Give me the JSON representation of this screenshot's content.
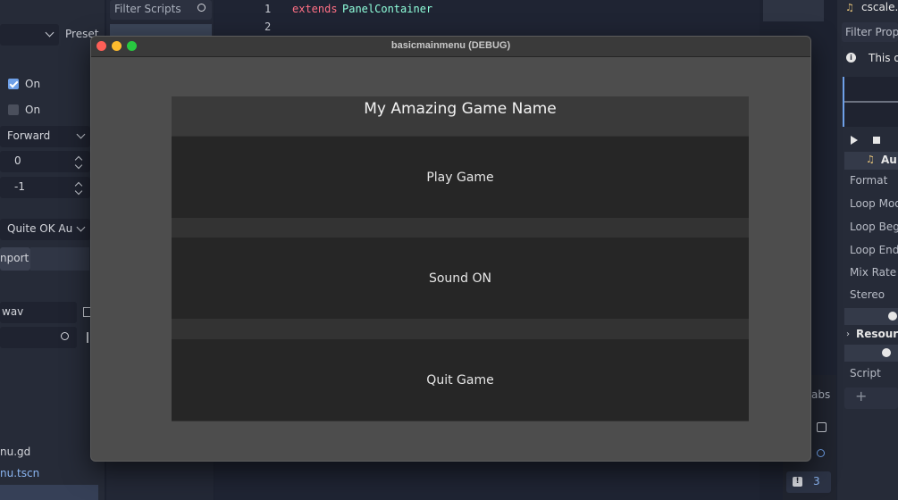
{
  "left_panel": {
    "dropdown_top": "",
    "checkbox_1_label": "On",
    "checkbox_2_label": "On",
    "loop_mode": "Forward",
    "value_a": "0",
    "value_b": "-1",
    "compress_mode": "Quite OK Au",
    "import_button": "nport",
    "file_field": "wav",
    "file_1": "nu.gd",
    "file_2": "nu.tscn"
  },
  "script_panel": {
    "filter_placeholder": "Filter Scripts"
  },
  "preset_label": "Preset",
  "code": {
    "lines": [
      {
        "num": "1",
        "keyword": "extends",
        "type": "PanelContainer"
      },
      {
        "num": "2",
        "keyword": "",
        "type": ""
      }
    ]
  },
  "right_panel": {
    "file_name": "cscale.w",
    "filter_placeholder": "Filter Propo",
    "info_text": "This o",
    "resource_name": "Au",
    "properties": [
      "Format",
      "Loop Mod",
      "Loop Beg",
      "Loop End",
      "Mix Rate",
      "Stereo"
    ],
    "resource_section": "Resourc",
    "script_label": "Script"
  },
  "bottom": {
    "tabs_text": "abs",
    "warning_count": "3"
  },
  "game_window": {
    "title": "basicmainmenu (DEBUG)",
    "game_name": "My Amazing Game Name",
    "buttons": {
      "play": "Play Game",
      "sound": "Sound ON",
      "quit": "Quit Game"
    }
  },
  "colors": {
    "checkbox_on": "#6ea0e8",
    "keyword": "#ff7085",
    "type": "#8fffdb",
    "close": "#fe5f57",
    "minimize": "#febc2e",
    "maximize": "#28c840"
  }
}
